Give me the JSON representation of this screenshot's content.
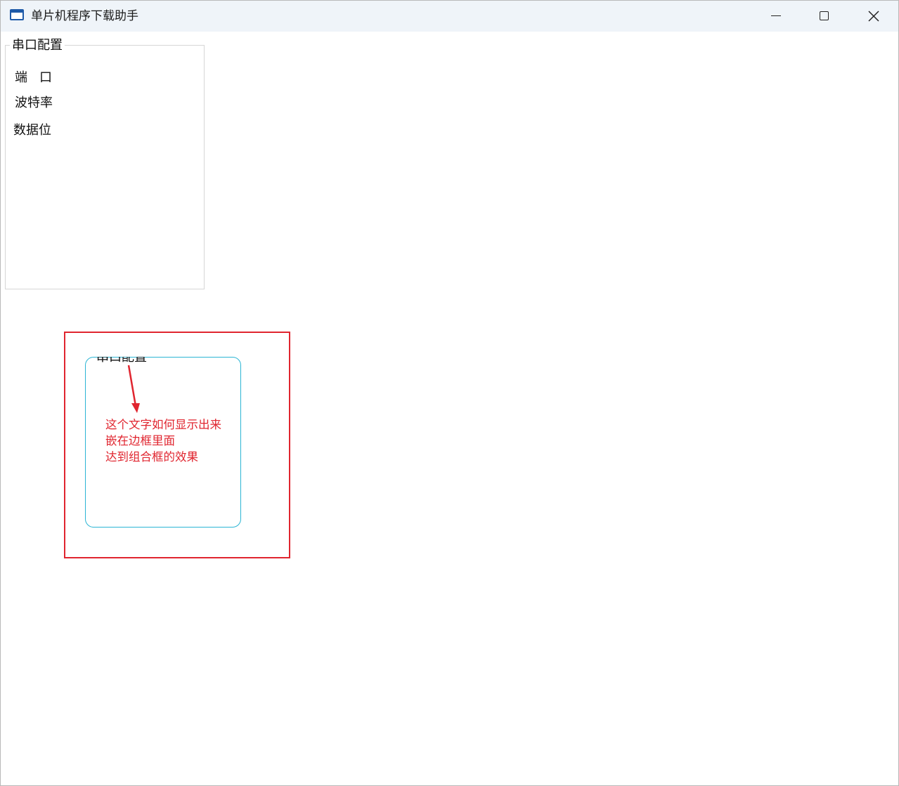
{
  "window": {
    "title": "单片机程序下载助手",
    "app_icon": "window-app-icon",
    "controls": {
      "minimize_icon": "minimize-icon",
      "maximize_icon": "maximize-icon",
      "close_icon": "close-icon"
    }
  },
  "serial_config": {
    "group_title": "串口配置",
    "labels": {
      "port": "端口",
      "baud_rate": "波特率",
      "data_bits": "数据位"
    }
  },
  "annotation": {
    "clipped_group_title": "串口配置",
    "note_lines": [
      "这个文字如何显示出来",
      "嵌在边框里面",
      "达到组合框的效果"
    ],
    "colors": {
      "highlight": "#e0252f",
      "border": "#2bb5d4"
    }
  }
}
